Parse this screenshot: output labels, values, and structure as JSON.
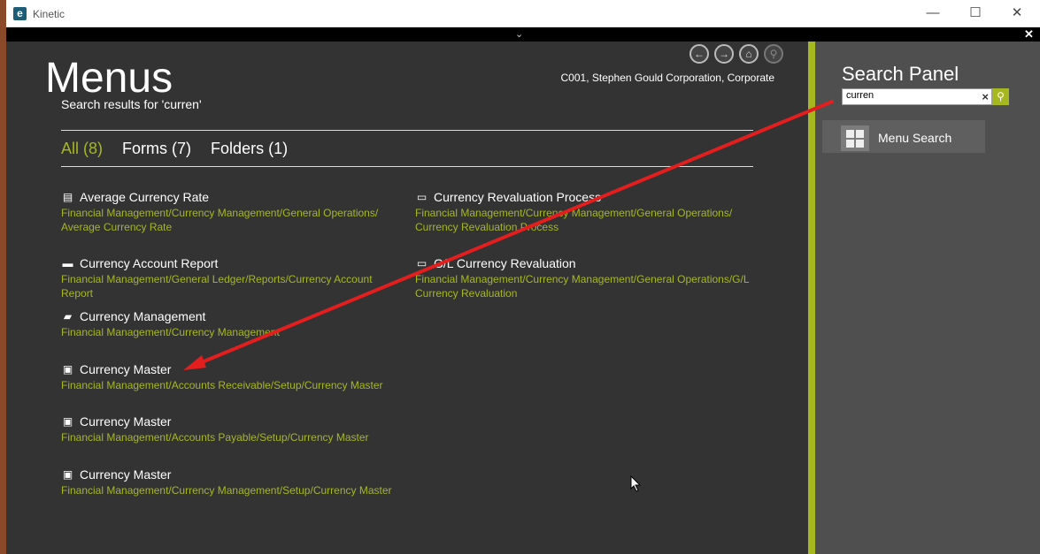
{
  "window": {
    "title": "Kinetic",
    "logo_letter": "e"
  },
  "titlebar": {
    "minimize": "—",
    "maximize": "☐",
    "close": "✕"
  },
  "strip": {
    "chevron": "⌄",
    "close": "✕"
  },
  "header": {
    "title": "Menus",
    "results_label": "Search results for 'curren'",
    "company": "C001, Stephen Gould Corporation, Corporate"
  },
  "tabs": [
    {
      "label": "All (8)",
      "active": true
    },
    {
      "label": "Forms (7)",
      "active": false
    },
    {
      "label": "Folders (1)",
      "active": false
    }
  ],
  "results": [
    {
      "title": "Average Currency Rate",
      "icon": "report-search-icon",
      "path": "Financial Management/Currency Management/General Operations/ Average Currency Rate"
    },
    {
      "title": "Currency Revaluation Process",
      "icon": "process-icon",
      "path": "Financial Management/Currency Management/General Operations/ Currency Revaluation Process"
    },
    {
      "title": "Currency Account Report",
      "icon": "printer-icon",
      "path": "Financial Management/General Ledger/Reports/Currency Account Report"
    },
    {
      "title": "G/L Currency Revaluation",
      "icon": "process-icon",
      "path": "Financial Management/Currency Management/General Operations/G/L Currency Revaluation"
    },
    {
      "title": "Currency Management",
      "icon": "folder-icon",
      "path": "Financial Management/Currency Management"
    },
    {
      "title": "Currency Master",
      "icon": "form-icon",
      "path": "Financial Management/Accounts Receivable/Setup/Currency Master"
    },
    {
      "title": "Currency Master",
      "icon": "form-icon",
      "path": "Financial Management/Accounts Payable/Setup/Currency Master"
    },
    {
      "title": "Currency Master",
      "icon": "form-icon",
      "path": "Financial Management/Currency Management/Setup/Currency Master"
    }
  ],
  "panel": {
    "title": "Search Panel",
    "search_value": "curren",
    "menu_search_label": "Menu Search"
  },
  "colors": {
    "accent": "#a6b81f",
    "background": "#333333",
    "panel": "#4f4f4f",
    "annotation_arrow": "#e41e1e"
  }
}
